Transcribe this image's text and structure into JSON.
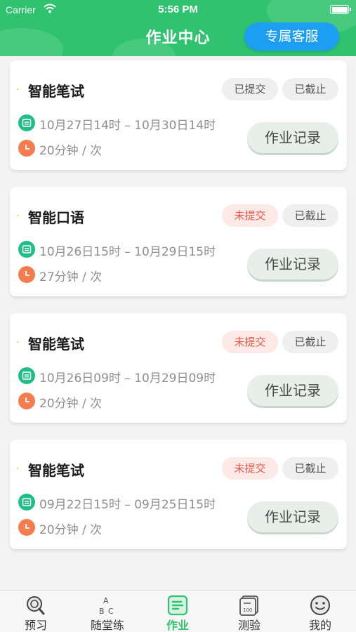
{
  "status_bar": {
    "carrier": "Carrier",
    "time": "5:56 PM"
  },
  "header": {
    "title": "作业中心",
    "service_button": "专属客服"
  },
  "colors": {
    "primary": "#2fc26f",
    "service": "#1c9ef3",
    "unsubmitted": "#e8584a"
  },
  "assignments": [
    {
      "title": "智能笔试",
      "submit_status": "已提交",
      "deadline_status": "已截止",
      "date_range": "10月27日14时 – 10月30日14时",
      "duration": "20分钟 / 次",
      "record_button": "作业记录"
    },
    {
      "title": "智能口语",
      "submit_status": "未提交",
      "deadline_status": "已截止",
      "date_range": "10月26日15时 – 10月29日15时",
      "duration": "27分钟 / 次",
      "record_button": "作业记录"
    },
    {
      "title": "智能笔试",
      "submit_status": "未提交",
      "deadline_status": "已截止",
      "date_range": "10月26日09时 – 10月29日09时",
      "duration": "20分钟 / 次",
      "record_button": "作业记录"
    },
    {
      "title": "智能笔试",
      "submit_status": "未提交",
      "deadline_status": "已截止",
      "date_range": "09月22日15时 – 09月25日15时",
      "duration": "20分钟 / 次",
      "record_button": "作业记录"
    }
  ],
  "icons": {
    "date": "calendar-icon",
    "duration": "clock-icon"
  },
  "tabbar": {
    "items": [
      {
        "label": "预习",
        "icon": "magnifier-icon"
      },
      {
        "label": "随堂练",
        "icon": "abc-icon"
      },
      {
        "label": "作业",
        "icon": "homework-icon",
        "active": true
      },
      {
        "label": "测验",
        "icon": "quiz-icon"
      },
      {
        "label": "我的",
        "icon": "face-icon"
      }
    ]
  }
}
